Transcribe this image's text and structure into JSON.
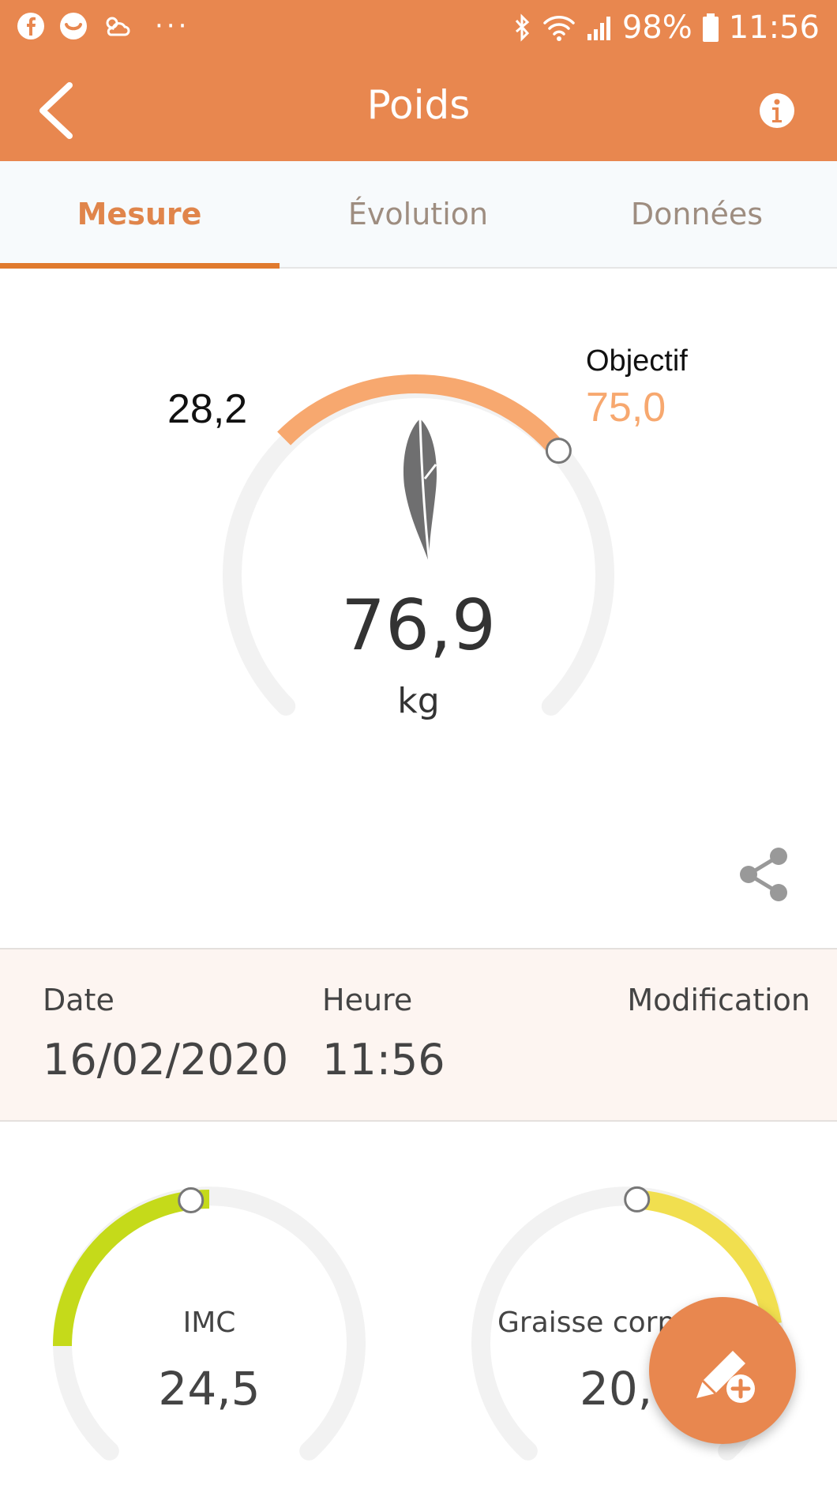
{
  "status_bar": {
    "battery": "98%",
    "time": "11:56",
    "left_icons": [
      "facebook-icon",
      "smile-icon",
      "weather-icon",
      "more-dots-icon"
    ],
    "right_icons": [
      "bluetooth-icon",
      "wifi-icon",
      "signal-icon",
      "battery-icon"
    ]
  },
  "app_bar": {
    "title": "Poids",
    "back_icon": "back-arrow-icon",
    "info_icon": "info-icon"
  },
  "tabs": [
    {
      "label": "Mesure",
      "active": true
    },
    {
      "label": "Évolution",
      "active": false
    },
    {
      "label": "Données",
      "active": false
    }
  ],
  "weight_gauge": {
    "value": "76,9",
    "unit": "kg",
    "left_value": "28,2",
    "goal_label": "Objectif",
    "goal_value": "75,0",
    "icon": "feather-icon",
    "accent_color": "#F7A86F"
  },
  "share_icon": "share-icon",
  "measurement_info": {
    "date_label": "Date",
    "date_value": "16/02/2020",
    "time_label": "Heure",
    "time_value": "11:56",
    "modification_label": "Modification"
  },
  "bmi_gauge": {
    "label": "IMC",
    "value": "24,5",
    "accent_color": "#C5DA1A"
  },
  "body_fat_gauge": {
    "label": "Graisse corp",
    "value": "20,",
    "accent_color": "#F1DF4F"
  },
  "fab": {
    "icon": "edit-add-icon"
  },
  "colors": {
    "primary": "#E8874F",
    "tab_active": "#E0854B"
  }
}
